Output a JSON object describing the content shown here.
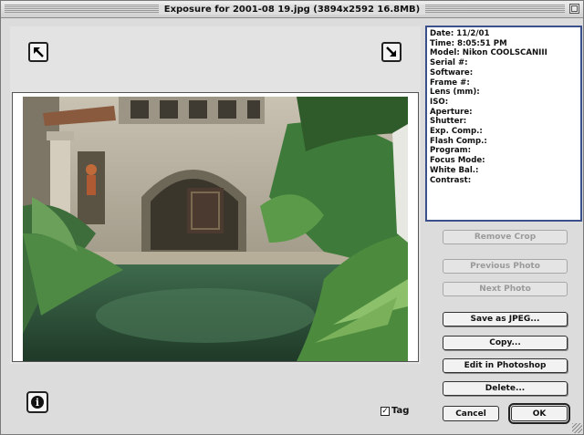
{
  "window": {
    "title": "Exposure for 2001-08 19.jpg (3894x2592 16.8MB)"
  },
  "exif": {
    "lines": [
      "Date: 11/2/01",
      "Time: 8:05:51 PM",
      "Model: Nikon COOLSCANIII",
      "Serial #:",
      "Software:",
      "Frame #:",
      "Lens (mm):",
      "ISO:",
      "Aperture:",
      "Shutter:",
      "Exp. Comp.:",
      "Flash Comp.:",
      "Program:",
      "Focus Mode:",
      "White Bal.:",
      "Contrast:"
    ]
  },
  "buttons": {
    "remove_crop": "Remove Crop",
    "previous_photo": "Previous Photo",
    "next_photo": "Next Photo",
    "save_jpeg": "Save as JPEG...",
    "copy": "Copy...",
    "edit_photoshop": "Edit in Photoshop",
    "delete": "Delete...",
    "cancel": "Cancel",
    "ok": "OK"
  },
  "tag": {
    "label": "Tag",
    "checked": true
  },
  "icons": {
    "rotate_left": "rotate-left-arrow",
    "rotate_right": "rotate-right-arrow",
    "info": "info-icon"
  }
}
